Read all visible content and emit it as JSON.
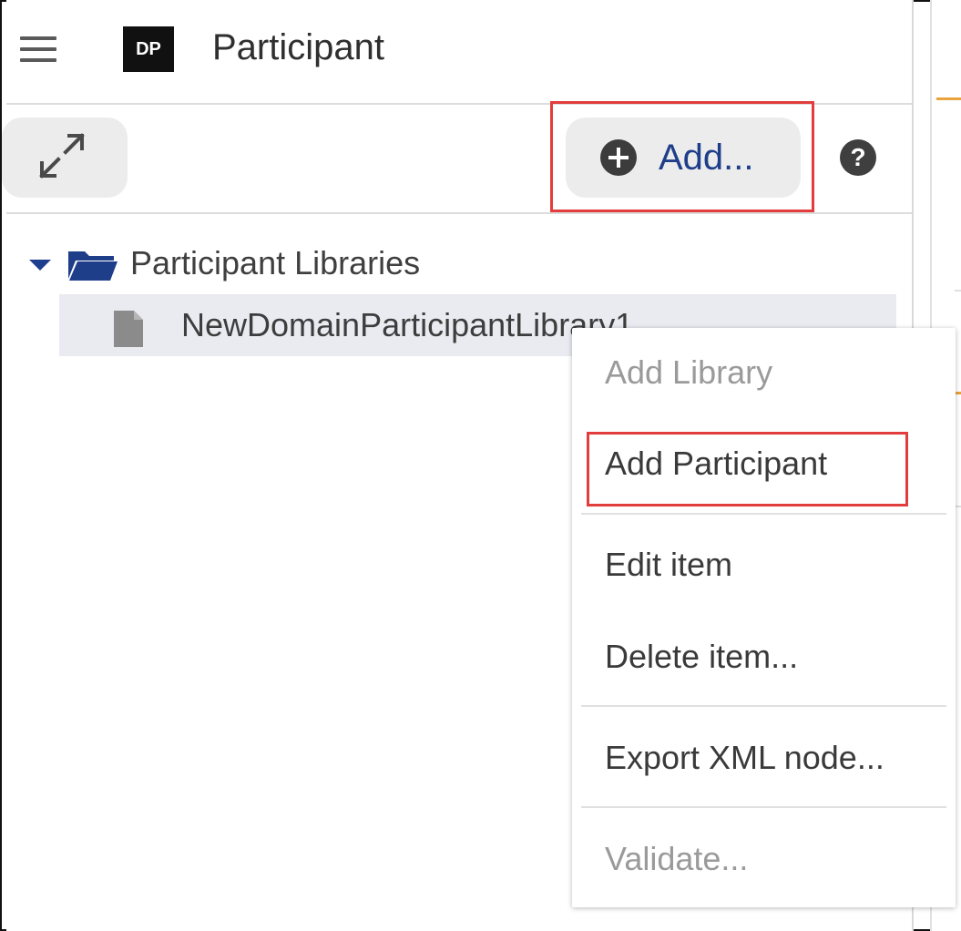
{
  "header": {
    "logo_text": "DP",
    "title": "Participant"
  },
  "toolbar": {
    "add_label": "Add...",
    "help_symbol": "?"
  },
  "tree": {
    "root_label": "Participant Libraries",
    "child_label": "NewDomainParticipantLibrary1"
  },
  "context_menu": {
    "items": [
      {
        "label": "Add Library",
        "enabled": false
      },
      {
        "label": "Add Participant",
        "enabled": true
      },
      {
        "label": "Edit item",
        "enabled": true
      },
      {
        "label": "Delete item...",
        "enabled": true
      },
      {
        "label": "Export XML node...",
        "enabled": true
      },
      {
        "label": "Validate...",
        "enabled": false
      }
    ]
  },
  "icons": [
    "menu-icon",
    "expand-icon",
    "add-circle-icon",
    "help-icon",
    "caret-down-icon",
    "folder-open-icon",
    "file-icon"
  ],
  "colors": {
    "accent_blue": "#1f3e8a",
    "highlight_red": "#e23c3c",
    "selected_row": "#e9ebf1"
  }
}
